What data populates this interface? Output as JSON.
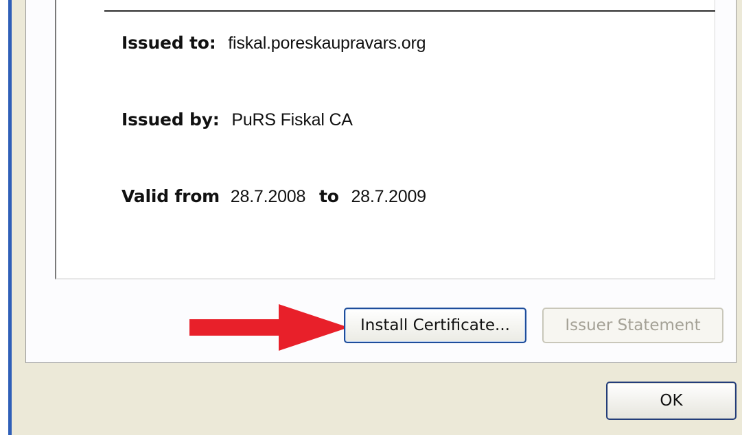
{
  "certificate": {
    "issued_to_label": "Issued to:",
    "issued_to_value": "fiskal.poreskaupravars.org",
    "issued_by_label": "Issued by:",
    "issued_by_value": "PuRS Fiskal CA",
    "valid_from_label": "Valid from",
    "valid_from_value": "28.7.2008",
    "valid_to_label": "to",
    "valid_to_value": "28.7.2009"
  },
  "buttons": {
    "install_certificate": "Install Certificate...",
    "issuer_statement": "Issuer Statement",
    "ok": "OK"
  },
  "annotation": {
    "arrow_icon": "red-arrow-right-icon",
    "arrow_color": "#e8202a"
  },
  "colors": {
    "dialog_background": "#ece9d8",
    "window_frame": "#2f5fb8",
    "focused_button_border": "#1e4d9b",
    "disabled_text": "#a4a196"
  }
}
